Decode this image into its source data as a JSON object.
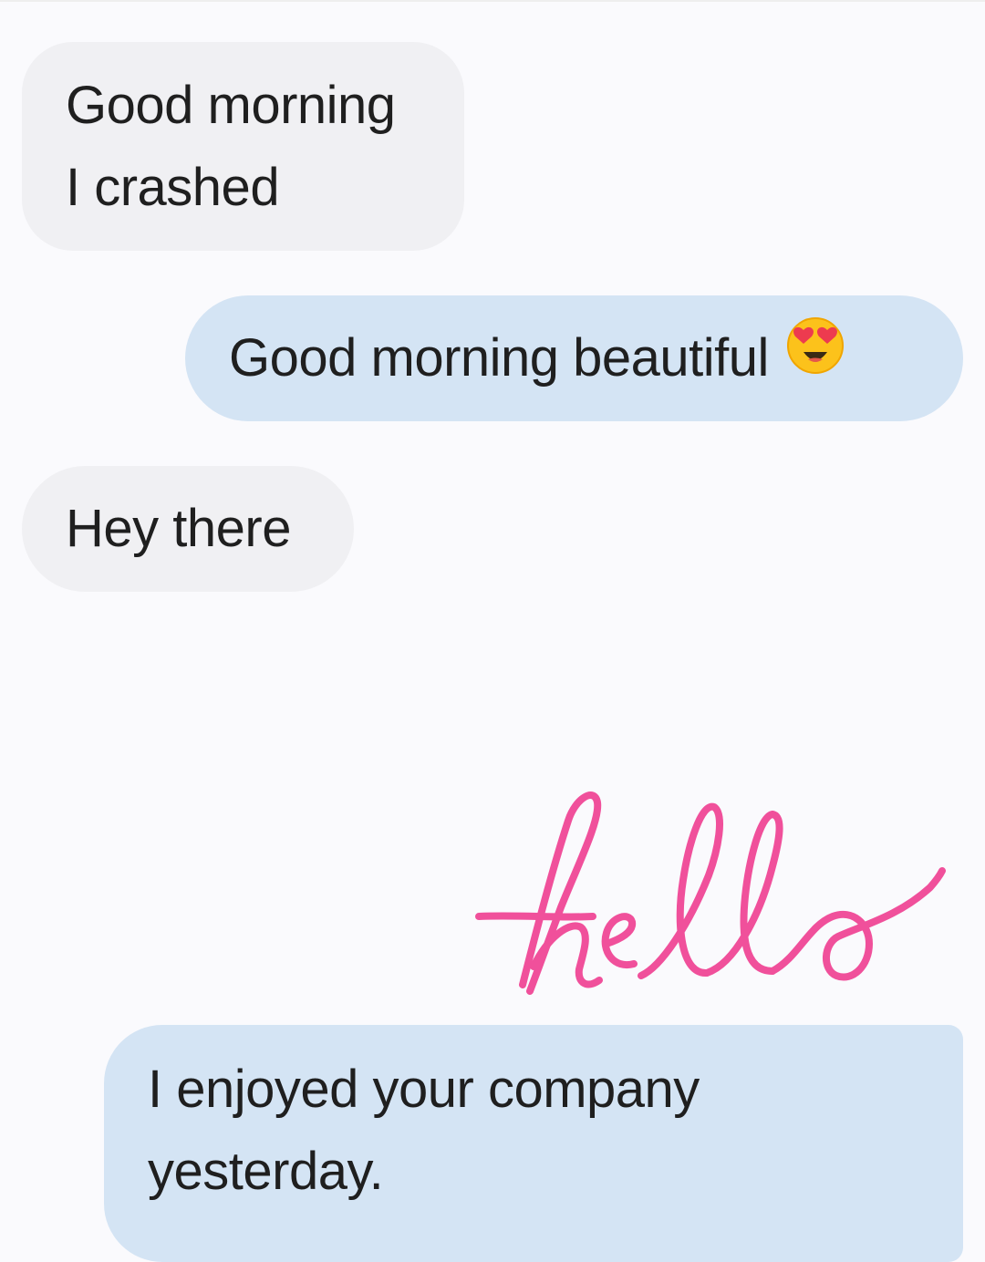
{
  "messages": [
    {
      "direction": "incoming",
      "lines": [
        "Good morning",
        "I crashed"
      ]
    },
    {
      "direction": "outgoing",
      "text": "Good morning beautiful",
      "emoji": "smiling-face-with-heart-eyes"
    },
    {
      "direction": "incoming",
      "lines": [
        "Hey there"
      ]
    },
    {
      "direction": "outgoing",
      "type": "handwriting",
      "handwriting_text": "hello",
      "ink_color": "#f0509b"
    },
    {
      "direction": "outgoing",
      "lines": [
        "I enjoyed your company",
        "yesterday."
      ]
    }
  ],
  "colors": {
    "background": "#fafafd",
    "incoming_bubble": "#f0f0f3",
    "outgoing_bubble": "#d4e4f4",
    "text": "#1f1f1f",
    "handwriting_ink": "#f0509b"
  }
}
